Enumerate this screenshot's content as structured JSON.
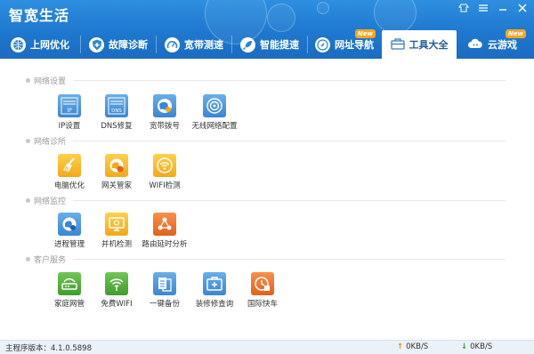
{
  "app": {
    "title": "智宽生活"
  },
  "nav": {
    "tabs": [
      {
        "label": "上网优化",
        "icon": "globe-icon",
        "badge": ""
      },
      {
        "label": "故障诊断",
        "icon": "shield-plus-icon",
        "badge": ""
      },
      {
        "label": "宽带测速",
        "icon": "speed-icon",
        "badge": ""
      },
      {
        "label": "智能提速",
        "icon": "rocket-icon",
        "badge": ""
      },
      {
        "label": "网址导航",
        "icon": "compass-icon",
        "badge": "New"
      },
      {
        "label": "工具大全",
        "icon": "toolbox-icon",
        "badge": "",
        "active": true
      },
      {
        "label": "云游戏",
        "icon": "cloud-icon",
        "badge": "New"
      }
    ]
  },
  "sections": {
    "network_settings": {
      "title": "网络设置",
      "tools": [
        {
          "label": "IP设置",
          "icon": "ip-settings-icon",
          "icon_text": "IP",
          "color": "#4a94dc"
        },
        {
          "label": "DNS修复",
          "icon": "dns-repair-icon",
          "icon_text": "DNS",
          "color": "#4a94dc"
        },
        {
          "label": "宽带拨号",
          "icon": "broadband-dial-icon",
          "color": "#4a94dc"
        },
        {
          "label": "无线网络配置",
          "icon": "wireless-config-icon",
          "color": "#4a94dc"
        }
      ]
    },
    "network_diagnosis": {
      "title": "网络诊所",
      "tools": [
        {
          "label": "电脑优化",
          "icon": "broom-icon",
          "color": "#f2b233"
        },
        {
          "label": "网关管家",
          "icon": "gateway-manager-icon",
          "color": "#f2b233"
        },
        {
          "label": "WIFI检测",
          "icon": "wifi-detect-icon",
          "color": "#f2b233"
        }
      ]
    },
    "network_monitor": {
      "title": "网络监控",
      "tools": [
        {
          "label": "进程管理",
          "icon": "process-manager-icon",
          "color": "#4a94dc"
        },
        {
          "label": "并机检测",
          "icon": "monitor-check-icon",
          "color": "#f2b233"
        },
        {
          "label": "路由延时分析",
          "icon": "route-latency-icon",
          "color": "#e8692a"
        }
      ]
    },
    "customer_service": {
      "title": "客户服务",
      "tools": [
        {
          "label": "家庭网管",
          "icon": "router-icon",
          "color": "#52ad3a"
        },
        {
          "label": "免费WIFI",
          "icon": "free-wifi-icon",
          "color": "#52ad3a"
        },
        {
          "label": "一键备份",
          "icon": "backup-icon",
          "color": "#4a94dc"
        },
        {
          "label": "装修修查询",
          "icon": "repair-query-icon",
          "color": "#4a94dc"
        },
        {
          "label": "国际快车",
          "icon": "international-express-icon",
          "color": "#e8692a"
        }
      ]
    }
  },
  "status": {
    "version_label": "主程序版本：",
    "version": "4.1.0.5898",
    "upload": "0KB/S",
    "download": "0KB/S"
  }
}
